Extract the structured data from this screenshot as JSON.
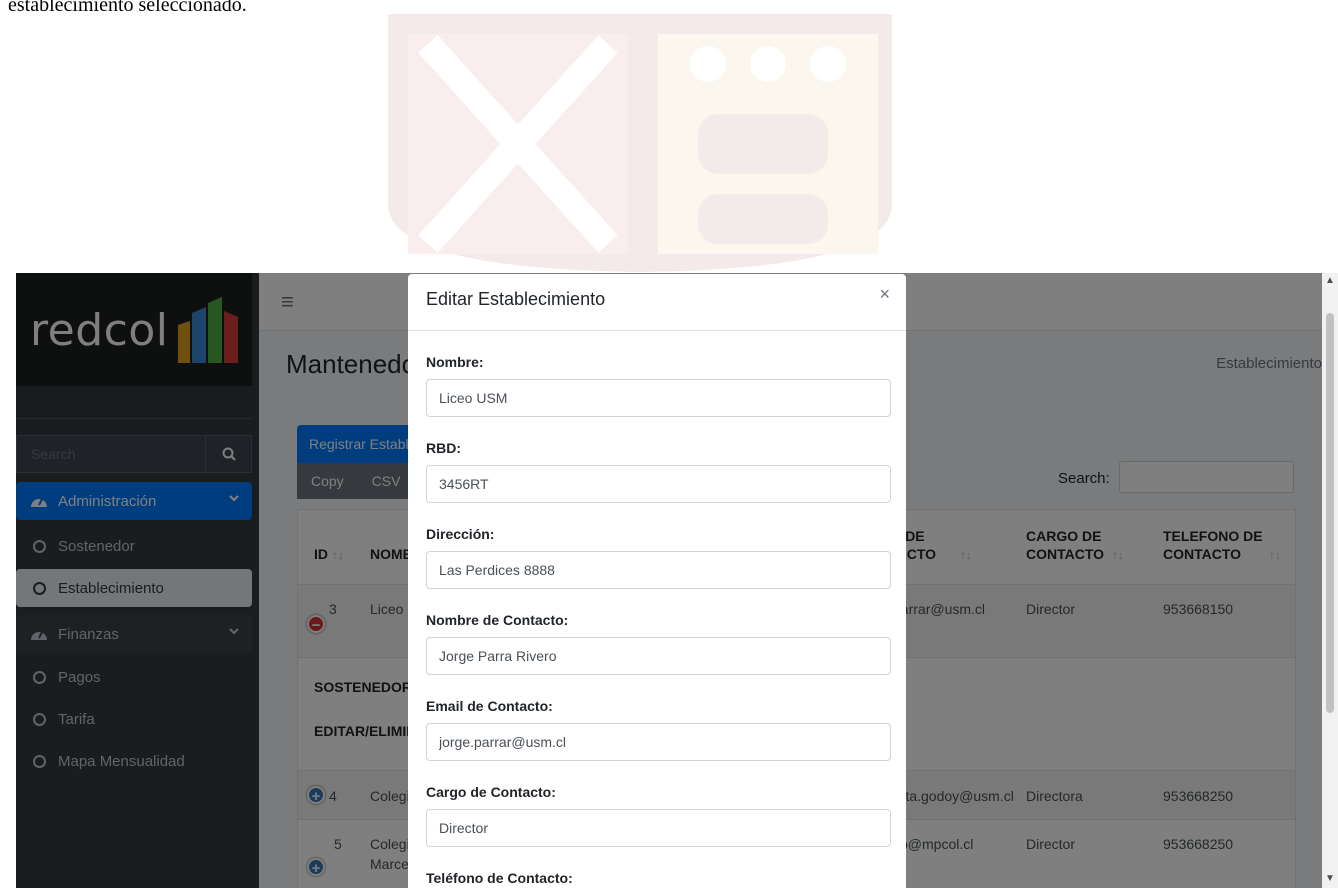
{
  "doc": {
    "intro_text": "establecimiento seleccionado."
  },
  "sidebar": {
    "brand": "redcol",
    "search_placeholder": "Search",
    "items": [
      {
        "label": "Administración"
      },
      {
        "label": "Sostenedor"
      },
      {
        "label": "Establecimiento"
      },
      {
        "label": "Finanzas"
      },
      {
        "label": "Pagos"
      },
      {
        "label": "Tarifa"
      },
      {
        "label": "Mapa Mensualidad"
      }
    ]
  },
  "header": {
    "page_title": "Mantenedor",
    "breadcrumb": "Establecimiento"
  },
  "toolbar": {
    "register_label": "Registrar Establecimiento",
    "copy_label": "Copy",
    "csv_label": "CSV",
    "search_label": "Search:"
  },
  "table": {
    "columns": {
      "id": "ID",
      "nombre": "NOMBRE",
      "email_line1": "EMAIL DE",
      "email_line2": "CONTACTO",
      "cargo_line1": "CARGO DE",
      "cargo_line2": "CONTACTO",
      "tel_line1": "TELEFONO DE",
      "tel_line2": "CONTACTO"
    },
    "rows": [
      {
        "id": "3",
        "nombre": "Liceo USM",
        "email": "jorge.parrar@usm.cl",
        "cargo": "Director",
        "telefono": "953668150"
      },
      {
        "id": "4",
        "nombre": "Colegio",
        "email": "margarita.godoy@usm.cl",
        "cargo": "Directora",
        "telefono": "953668250"
      },
      {
        "id": "5",
        "nombre_line1": "Colegio",
        "nombre_line2": "Marcela",
        "email": "marcelo@mpcol.cl",
        "cargo": "Director",
        "telefono": "953668250"
      }
    ],
    "child": {
      "sostenedor_label": "SOSTENEDOR",
      "editar_label": "EDITAR/ELIMINAR"
    }
  },
  "modal": {
    "title": "Editar Establecimiento",
    "close": "×",
    "fields": [
      {
        "label": "Nombre:",
        "value": "Liceo USM"
      },
      {
        "label": "RBD:",
        "value": "3456RT"
      },
      {
        "label": "Dirección:",
        "value": "Las Perdices 8888"
      },
      {
        "label": "Nombre de Contacto:",
        "value": "Jorge Parra Rivero"
      },
      {
        "label": "Email de Contacto:",
        "value": "jorge.parrar@usm.cl"
      },
      {
        "label": "Cargo de Contacto:",
        "value": "Director"
      },
      {
        "label": "Teléfono de Contacto:",
        "value": ""
      }
    ]
  },
  "colors": {
    "primary": "#007bff",
    "sidebar": "#343a40",
    "secondary": "#6c757d",
    "danger": "#d33333",
    "info": "#337ab7"
  }
}
